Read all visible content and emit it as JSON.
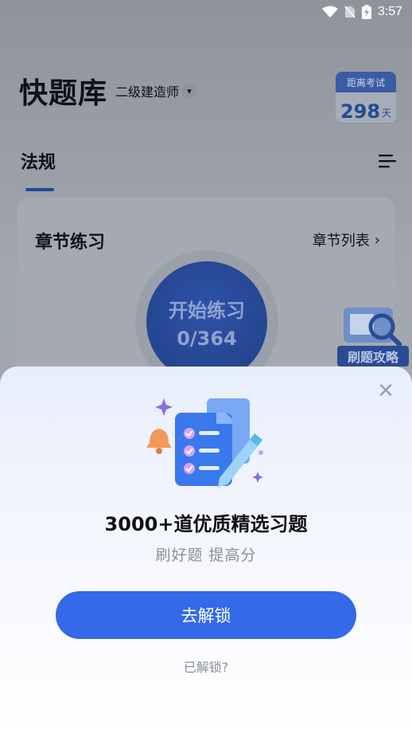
{
  "status_bar": {
    "time": "3:57",
    "icons": [
      "wifi-icon",
      "no-sim-icon",
      "battery-charging-icon"
    ]
  },
  "header": {
    "title": "快题库",
    "subject": "二级建造师"
  },
  "exam_badge": {
    "label": "距离考试",
    "days": "298",
    "unit": "天"
  },
  "tabs": {
    "active": "法规"
  },
  "card": {
    "title": "章节练习",
    "link": "章节列表",
    "start_label": "开始练习",
    "progress": "0/364"
  },
  "floating": {
    "label": "刷题攻略"
  },
  "modal": {
    "title": "3000+道优质精选习题",
    "subtitle": "刷好题  提高分",
    "cta": "去解锁",
    "secondary": "已解锁?"
  },
  "colors": {
    "primary": "#3469E7",
    "brand_dark": "#213F84"
  }
}
